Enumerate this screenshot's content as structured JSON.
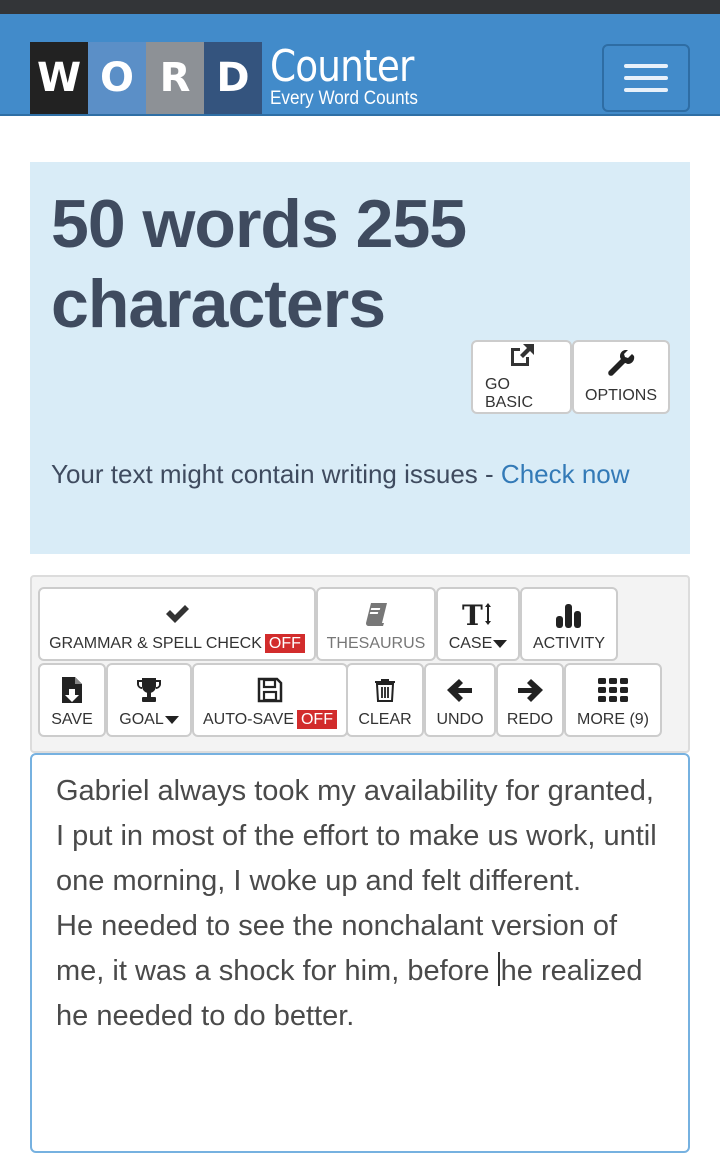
{
  "header": {
    "logo_letters": [
      "W",
      "O",
      "R",
      "D"
    ],
    "logo_title": "Counter",
    "logo_tagline": "Every Word Counts",
    "menu_icon": "hamburger-menu-icon",
    "colors": {
      "navbar": "#428bca",
      "tile1": "#222222",
      "tile2": "#5b8fc7",
      "tile3": "#8d9196",
      "tile4": "#34547e"
    }
  },
  "counter": {
    "headline": "50 words 255 characters",
    "word_count": 50,
    "character_count": 255,
    "buttons": [
      {
        "label": "GO BASIC",
        "icon": "external-link-icon"
      },
      {
        "label": "OPTIONS",
        "icon": "wrench-icon"
      }
    ],
    "issues_text": "Your text might contain writing issues - ",
    "issues_link": "Check now",
    "colors": {
      "panel_bg": "#d9ecf7",
      "link": "#337ab7"
    }
  },
  "toolbar": {
    "grammar": {
      "label": "GRAMMAR & SPELL CHECK",
      "state": "OFF",
      "icon": "checkmark-icon"
    },
    "thesaurus": {
      "label": "THESAURUS",
      "icon": "book-icon"
    },
    "case": {
      "label": "CASE",
      "icon": "text-height-icon"
    },
    "activity": {
      "label": "ACTIVITY",
      "icon": "bar-chart-icon"
    },
    "save": {
      "label": "SAVE",
      "icon": "file-download-icon"
    },
    "goal": {
      "label": "GOAL",
      "icon": "trophy-icon"
    },
    "autosave": {
      "label": "AUTO-SAVE",
      "state": "OFF",
      "icon": "floppy-disk-icon"
    },
    "clear": {
      "label": "CLEAR",
      "icon": "trash-icon"
    },
    "undo": {
      "label": "UNDO",
      "icon": "arrow-left-icon"
    },
    "redo": {
      "label": "REDO",
      "icon": "arrow-right-icon"
    },
    "more": {
      "label": "MORE (9)",
      "icon": "grid-icon"
    },
    "colors": {
      "off_badge": "#d22c2c"
    }
  },
  "editor": {
    "paragraph1": "Gabriel always took my availability for granted, I put in most of the effort to make us work, until one morning, I woke up and felt different.",
    "paragraph2_before_cursor": "He needed to see the nonchalant version of me, it was a shock for him, before ",
    "paragraph2_after_cursor": "he realized he needed to do better."
  }
}
